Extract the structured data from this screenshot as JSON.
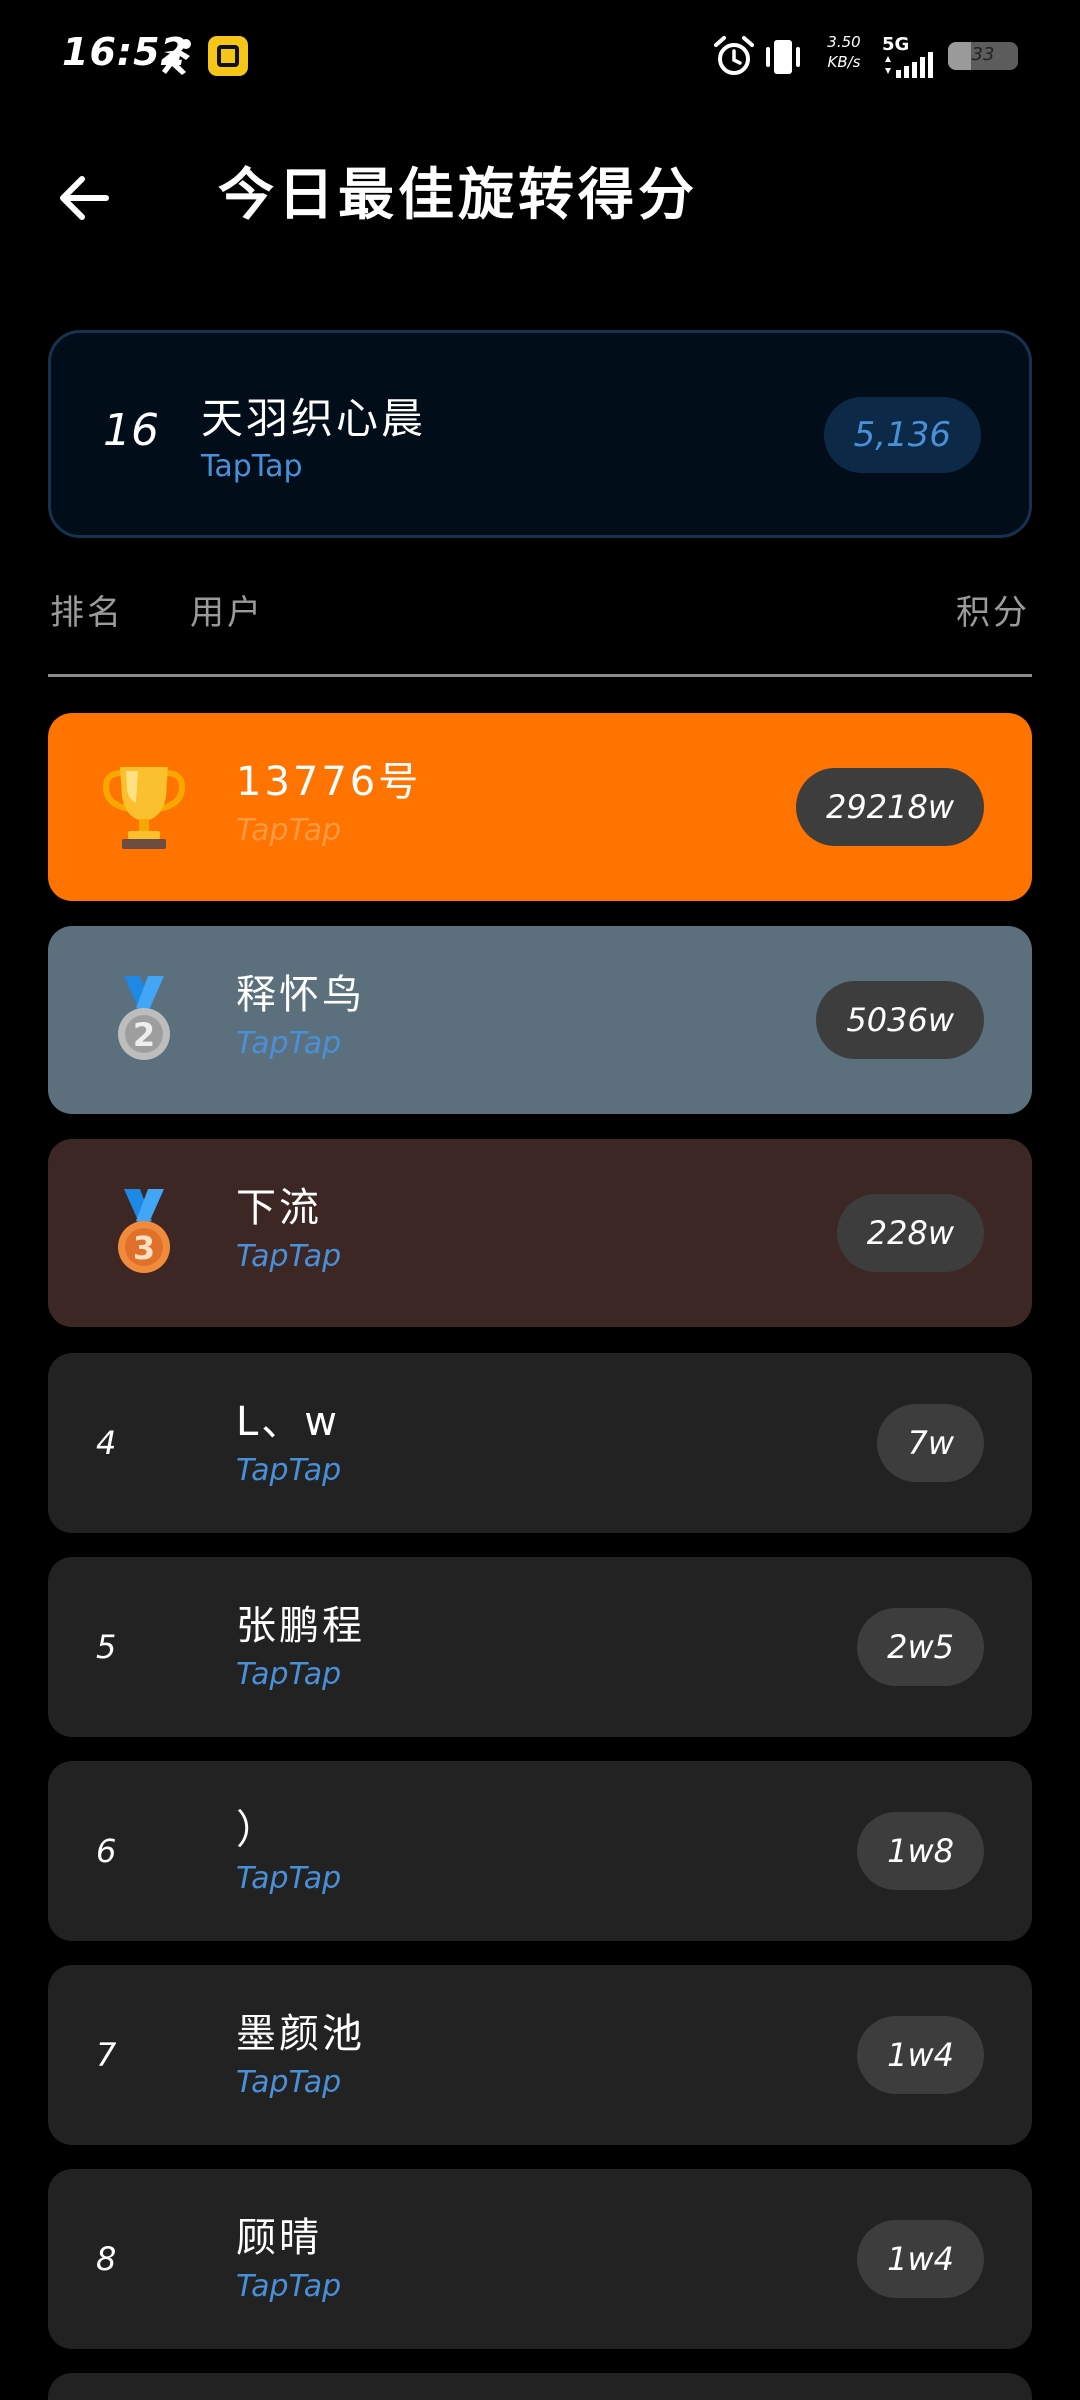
{
  "status_bar": {
    "time": "16:52",
    "net_speed": "3.50",
    "net_speed_unit": "KB/s",
    "network": "5G",
    "battery": "33",
    "battery_level": 0.33
  },
  "header": {
    "title": "今日最佳旋转得分"
  },
  "my_rank": {
    "rank": "16",
    "name": "天羽织心晨",
    "source": "TapTap",
    "score": "5,136"
  },
  "columns": {
    "rank": "排名",
    "user": "用户",
    "score": "积分"
  },
  "leaderboard": [
    {
      "rank": "1",
      "medal": "trophy-icon",
      "name": "13776号",
      "source": "TapTap",
      "score": "29218w"
    },
    {
      "rank": "2",
      "medal": "silver-medal-icon",
      "name": "释怀鸟",
      "source": "TapTap",
      "score": "5036w"
    },
    {
      "rank": "3",
      "medal": "bronze-medal-icon",
      "name": "下流",
      "source": "TapTap",
      "score": "228w"
    },
    {
      "rank": "4",
      "name": "L、w",
      "source": "TapTap",
      "score": "7w"
    },
    {
      "rank": "5",
      "name": "张鹏程",
      "source": "TapTap",
      "score": "2w5"
    },
    {
      "rank": "6",
      "name": "）",
      "source": "TapTap",
      "score": "1w8"
    },
    {
      "rank": "7",
      "name": "墨颜池",
      "source": "TapTap",
      "score": "1w4"
    },
    {
      "rank": "8",
      "name": "顾晴",
      "source": "TapTap",
      "score": "1w4"
    }
  ],
  "colors": {
    "background": "#000000",
    "gold_row": "#ff7300",
    "silver_row": "#5b707c",
    "bronze_row": "#3c2724",
    "plain_row": "#222222",
    "score_pill": "#3d3d3d",
    "source_text": "#4a90d9",
    "my_card_border": "#16324f"
  }
}
